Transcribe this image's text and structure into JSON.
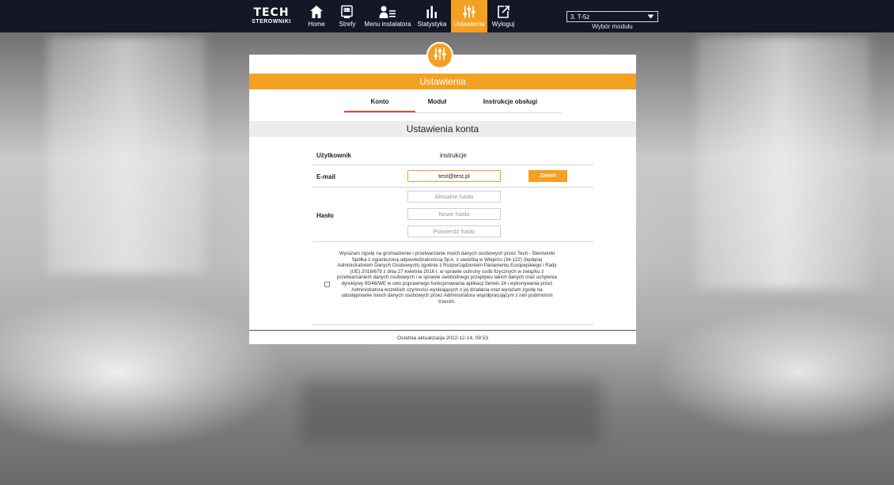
{
  "topbar": {
    "logo_main": "TECH",
    "logo_sub": "STEROWNIKI",
    "nav": {
      "home": "Home",
      "zones": "Strefy",
      "installer": "Menu instalatora",
      "stats": "Statystyka",
      "settings": "Ustawienia",
      "logout": "Wyloguj"
    },
    "zones_icon_text": "21.5",
    "module_selected": "3. T-5z",
    "module_label": "Wybór modułu"
  },
  "colors": {
    "topbar_bg": "#131726",
    "accent": "#f4a022",
    "active_tab_underline": "#e04a3a"
  },
  "panel": {
    "header": "Ustawienia",
    "tabs": {
      "konto": "Konto",
      "modul": "Moduł",
      "instrukcje": "Instrukcje obsługi"
    },
    "section_title": "Ustawienia konta",
    "user_label": "Użytkownik",
    "user_value": "instrukcje",
    "email_label": "E-mail",
    "email_value": "test@test.pl",
    "change_button": "Zmień",
    "password_label": "Hasło",
    "password_current_placeholder": "Aktualne hasło",
    "password_new_placeholder": "Nowe hasło",
    "password_confirm_placeholder": "Potwierdź hasło",
    "consent_text": "Wyrażam zgodę na gromadzenie i przetwarzanie moich danych osobowych przez Tech - Sterowniki Spółka z ograniczoną odpowiedzialnością Sp.k. z siedzibą w Wieprzu (34-122) (będącej Administratorem Danych Osobowych) zgodnie z Rozporządzeniem Parlamentu Europejskiego i Rady (UE) 2016/679 z dnia 27 kwietnia 2016 r. w sprawie ochrony osób fizycznych w związku z przetwarzaniem danych osobowych i w sprawie swobodnego przepływu takich danych oraz uchylenia dyrektywy 95/46/WE w celu poprawnego funkcjonowania aplikacji Serwis 24 i wykonywania przez Administratora wszelkich czynności wynikających z jej działania oraz wyrażam zgodę na udostępnianie moich danych osobowych przez Administratora współpracującym z nim podmiotom trzecim.",
    "consent_checked": false,
    "footer": "Ostatnia aktualizacja 2022-12-14, 09:53"
  }
}
